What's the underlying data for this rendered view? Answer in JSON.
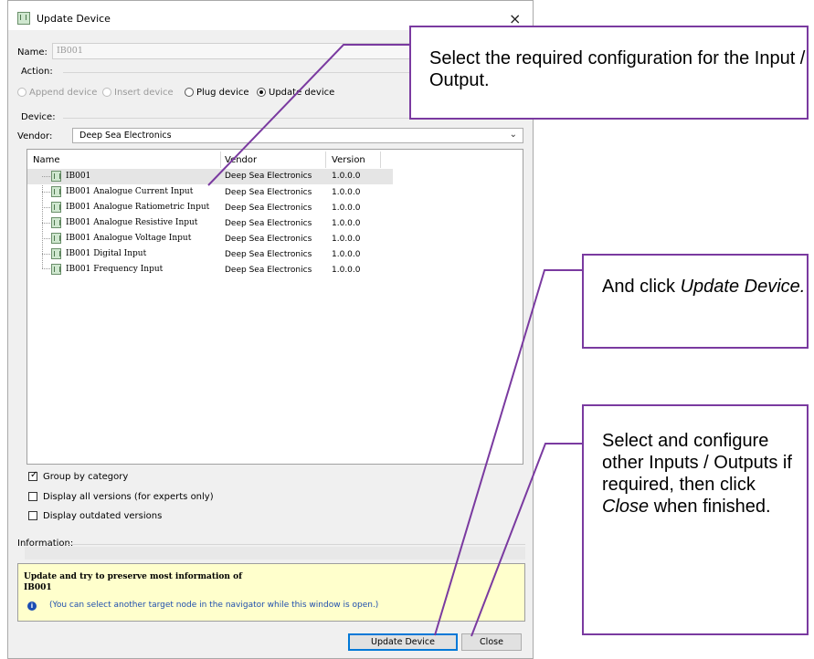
{
  "dialog": {
    "title": "Update Device",
    "close_glyph": "×",
    "name_label": "Name:",
    "name_value": "IB001",
    "action_label": "Action:",
    "actions": [
      {
        "label": "Append device",
        "enabled": false,
        "selected": false
      },
      {
        "label": "Insert device",
        "enabled": false,
        "selected": false
      },
      {
        "label": "Plug device",
        "enabled": true,
        "selected": false
      },
      {
        "label": "Update device",
        "enabled": true,
        "selected": true
      }
    ],
    "device_label": "Device:",
    "vendor_label": "Vendor:",
    "vendor_value": "Deep Sea Electronics",
    "columns": {
      "name": "Name",
      "vendor": "Vendor",
      "version": "Version"
    },
    "rows": [
      {
        "name": "IB001",
        "vendor": "Deep Sea Electronics",
        "version": "1.0.0.0"
      },
      {
        "name": "IB001 Analogue Current Input",
        "vendor": "Deep Sea Electronics",
        "version": "1.0.0.0"
      },
      {
        "name": "IB001 Analogue Ratiometric Input",
        "vendor": "Deep Sea Electronics",
        "version": "1.0.0.0"
      },
      {
        "name": "IB001 Analogue Resistive Input",
        "vendor": "Deep Sea Electronics",
        "version": "1.0.0.0"
      },
      {
        "name": "IB001 Analogue Voltage Input",
        "vendor": "Deep Sea Electronics",
        "version": "1.0.0.0"
      },
      {
        "name": "IB001 Digital Input",
        "vendor": "Deep Sea Electronics",
        "version": "1.0.0.0"
      },
      {
        "name": "IB001 Frequency Input",
        "vendor": "Deep Sea Electronics",
        "version": "1.0.0.0"
      }
    ],
    "options": [
      {
        "label": "Group by category",
        "checked": true
      },
      {
        "label": "Display all versions (for experts only)",
        "checked": false
      },
      {
        "label": "Display outdated versions",
        "checked": false
      }
    ],
    "information_label": "Information:",
    "info_title": "Update and try to preserve most information of",
    "info_node": "IB001",
    "info_message": "(You can select another target node in the navigator while this window is open.)",
    "update_button": "Update Device",
    "close_button": "Close"
  },
  "callouts": {
    "c1": "Select the required configuration for the Input / Output.",
    "c2_pre": "And click ",
    "c2_em": "Update Device.",
    "c3_pre": "Select and configure other Inputs / Outputs if required, then click ",
    "c3_em": "Close",
    "c3_post": " when finished."
  },
  "colors": {
    "callout_border": "#7a3aa0",
    "info_bg": "#ffffcc",
    "focus_blue": "#0078d7"
  }
}
